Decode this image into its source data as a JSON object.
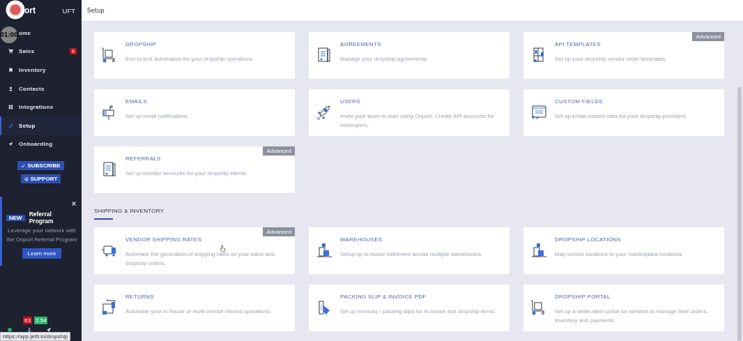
{
  "sidebar": {
    "logo": "ort",
    "account": "UFT",
    "nav": [
      {
        "label": "ome",
        "selected": false
      },
      {
        "label": "Sales",
        "selected": false,
        "badge": "9"
      },
      {
        "label": "Inventory",
        "selected": false
      },
      {
        "label": "Contacts",
        "selected": false
      },
      {
        "label": "Integrations",
        "selected": false
      },
      {
        "label": "Setup",
        "selected": true
      },
      {
        "label": "Onboarding",
        "selected": false
      }
    ],
    "buttons": [
      "SUBSCRIBE",
      "SUPPORT"
    ],
    "promo": {
      "badge": "NEW",
      "title": "Referral Program",
      "text": "Leverage your network with the Onport Referral Program",
      "button": "Learn more"
    },
    "counters": [
      {
        "value": "63",
        "color": "#c0121e"
      },
      {
        "value": "2.54",
        "color": "#2fb36a"
      }
    ]
  },
  "status_url": "https://app.jetti.io/dropship",
  "recorder": {
    "timer": "01:00"
  },
  "header": {
    "title": "Setup"
  },
  "sections": [
    {
      "cards": [
        {
          "title": "DROPSHIP",
          "description": "End to end automation for your dropship operations."
        },
        {
          "title": "AGREEMENTS",
          "description": "Manage your dropship agreements."
        },
        {
          "title": "API TEMPLATES",
          "description": "Set up your dropship vendor order templates.",
          "badge": "Advanced"
        },
        {
          "title": "EMAILS",
          "description": "Set up email notifications."
        },
        {
          "title": "USERS",
          "description": "Invite your team to start using Onport. Create API accounts for developers."
        },
        {
          "title": "CUSTOM FIELDS",
          "description": "Set up email custom data for your dropship providers."
        },
        {
          "title": "REFERRALS",
          "description": "Set up reseller accounts for your dropship clients.",
          "badge": "Advanced"
        }
      ]
    },
    {
      "title": "SHIPPING & INVENTORY",
      "cards": [
        {
          "title": "VENDOR SHIPPING RATES",
          "description": "Automate the generation of shipping rates on your sales and dropship orders.",
          "badge": "Advanced"
        },
        {
          "title": "WAREHOUSES",
          "description": "Setup up in-house fulfillment across multiple warehouses."
        },
        {
          "title": "DROPSHIP LOCATIONS",
          "description": "Map vendor locations to your marketplace locations."
        },
        {
          "title": "RETURNS",
          "description": "Automate your in-house or multi-vendor returns operations."
        },
        {
          "title": "PACKING SLIP & INVOICE PDF",
          "description": "Set up invoices / packing slips for in-house and dropship items."
        },
        {
          "title": "DROPSHIP PORTAL",
          "description": "Set up a white-label portal for vendors to manage their orders, inventory and payments."
        }
      ]
    }
  ]
}
